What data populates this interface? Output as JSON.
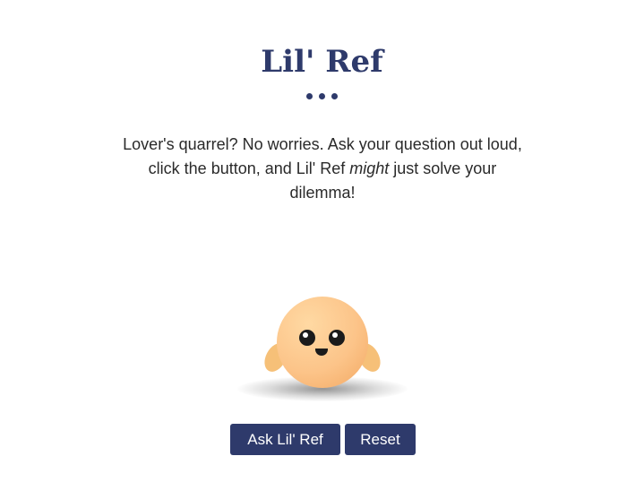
{
  "header": {
    "title": "Lil' Ref"
  },
  "description": {
    "part1": "Lover's quarrel? No worries. Ask your question out loud, click the button, and Lil' Ref ",
    "emphasis": "might",
    "part2": " just solve your dilemma!"
  },
  "actions": {
    "ask_label": "Ask Lil' Ref",
    "reset_label": "Reset"
  },
  "colors": {
    "accent": "#2e3a6b",
    "character_skin": "#fcc489"
  }
}
